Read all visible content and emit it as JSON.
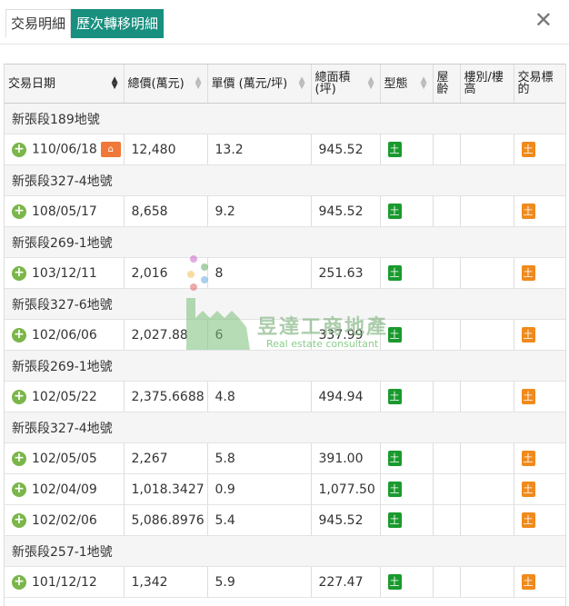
{
  "tabs": [
    {
      "label": "交易明細",
      "active": false
    },
    {
      "label": "歷次轉移明細",
      "active": true
    }
  ],
  "close_symbol": "✕",
  "columns": [
    {
      "label": "交易日期",
      "sort": "active"
    },
    {
      "label": "總價(萬元)",
      "sort": "both"
    },
    {
      "label": "單價 (萬元/坪)",
      "sort": "both"
    },
    {
      "label": "總面積\n(坪)",
      "sort": "both"
    },
    {
      "label": "型態",
      "sort": "both"
    },
    {
      "label": "屋齡",
      "sort": "none"
    },
    {
      "label": "樓別/樓高",
      "sort": "none"
    },
    {
      "label": "交易標的",
      "sort": "none"
    }
  ],
  "rows": [
    {
      "type": "group",
      "label": "新張段189地號"
    },
    {
      "type": "data",
      "date": "110/06/18",
      "total": "12,480",
      "unit": "13.2",
      "area": "945.52",
      "form": "土",
      "age": "",
      "floor": "",
      "target": "土",
      "search": true
    },
    {
      "type": "group",
      "label": "新張段327-4地號"
    },
    {
      "type": "data",
      "date": "108/05/17",
      "total": "8,658",
      "unit": "9.2",
      "area": "945.52",
      "form": "土",
      "age": "",
      "floor": "",
      "target": "土"
    },
    {
      "type": "group",
      "label": "新張段269-1地號"
    },
    {
      "type": "data",
      "date": "103/12/11",
      "total": "2,016",
      "unit": "8",
      "area": "251.63",
      "form": "土",
      "age": "",
      "floor": "",
      "target": "土"
    },
    {
      "type": "group",
      "label": "新張段327-6地號"
    },
    {
      "type": "data",
      "date": "102/06/06",
      "total": "2,027.88",
      "unit": "6",
      "area": "337.99",
      "form": "土",
      "age": "",
      "floor": "",
      "target": "土"
    },
    {
      "type": "group",
      "label": "新張段269-1地號"
    },
    {
      "type": "data",
      "date": "102/05/22",
      "total": "2,375.6688",
      "unit": "4.8",
      "area": "494.94",
      "form": "土",
      "age": "",
      "floor": "",
      "target": "土"
    },
    {
      "type": "group",
      "label": "新張段327-4地號"
    },
    {
      "type": "data",
      "date": "102/05/05",
      "total": "2,267",
      "unit": "5.8",
      "area": "391.00",
      "form": "土",
      "age": "",
      "floor": "",
      "target": "土"
    },
    {
      "type": "data",
      "date": "102/04/09",
      "total": "1,018.3427",
      "unit": "0.9",
      "area": "1,077.50",
      "form": "土",
      "age": "",
      "floor": "",
      "target": "土"
    },
    {
      "type": "data",
      "date": "102/02/06",
      "total": "5,086.8976",
      "unit": "5.4",
      "area": "945.52",
      "form": "土",
      "age": "",
      "floor": "",
      "target": "土"
    },
    {
      "type": "group",
      "label": "新張段257-1地號"
    },
    {
      "type": "data",
      "date": "101/12/12",
      "total": "1,342",
      "unit": "5.9",
      "area": "227.47",
      "form": "土",
      "age": "",
      "floor": "",
      "target": "土"
    }
  ],
  "watermark": {
    "title": "昱達工商地產",
    "subtitle": "Real estate consultant"
  },
  "colors": {
    "tab_active": "#188f7f",
    "plus": "#7ab64a",
    "badge_form": "#1a9a2e",
    "badge_target": "#f08a1c",
    "search_icon": "#f07838"
  }
}
